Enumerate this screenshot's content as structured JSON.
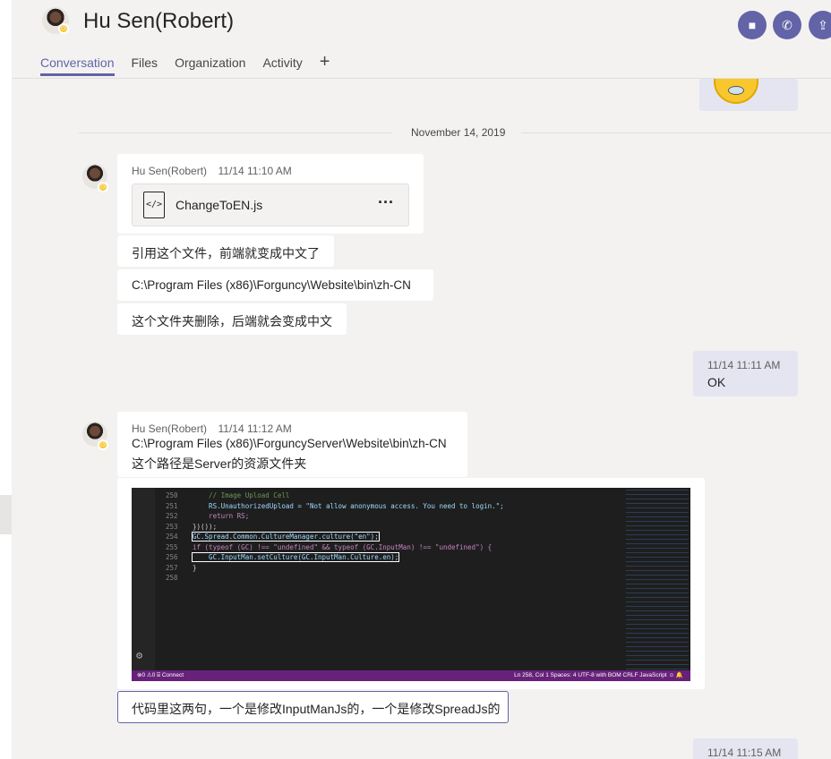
{
  "header": {
    "title": "Hu Sen(Robert)",
    "tabs": [
      {
        "label": "Conversation",
        "active": true
      },
      {
        "label": "Files"
      },
      {
        "label": "Organization"
      },
      {
        "label": "Activity"
      }
    ],
    "add_tab_icon": "+",
    "calls": [
      "video-icon",
      "phone-icon",
      "share-screen-icon"
    ]
  },
  "date_separator": "November 14, 2019",
  "messages": {
    "m1": {
      "sender": "Hu Sen(Robert)",
      "time": "11/14 11:10 AM",
      "file_name": "ChangeToEN.js",
      "file_more": "···"
    },
    "m2": {
      "text": "引用这个文件，前端就变成中文了"
    },
    "m3": {
      "text": "C:\\Program Files (x86)\\Forguncy\\Website\\bin\\zh-CN"
    },
    "m4": {
      "text": "这个文件夹删除，后端就会变成中文"
    },
    "me1": {
      "time": "11/14 11:11 AM",
      "text": "OK"
    },
    "m5": {
      "sender": "Hu Sen(Robert)",
      "time": "11/14 11:12 AM",
      "line1": "C:\\Program Files (x86)\\ForguncyServer\\Website\\bin\\zh-CN",
      "line2": "这个路径是Server的资源文件夹"
    },
    "m6": {
      "text": "代码里这两句，一个是修改InputManJs的，一个是修改SpreadJs的"
    },
    "me2": {
      "time": "11/14 11:15 AM"
    }
  },
  "code_screenshot": {
    "line_numbers": [
      "250",
      "251",
      "252",
      "253",
      "254",
      "255",
      "256",
      "257",
      "258"
    ],
    "lines": [
      "    // Image Upload Cell",
      "    RS.UnauthorizedUpload = \"Not allow anonymous access. You need to login.\";",
      "    return RS;",
      "})());",
      "GC.Spread.Common.CultureManager.culture(\"en\");",
      "if (typeof (GC) !== \"undefined\" && typeof (GC.InputMan) !== \"undefined\") {",
      "    GC.InputMan.setCulture(GC.InputMan.Culture.en);",
      "}",
      ""
    ],
    "status_left": "⊗0 ⚠0   ⌸ Connect",
    "status_right": "Ln 258, Col 1    Spaces: 4    UTF-8 with BOM    CRLF    JavaScript    ☺  🔔"
  },
  "colors": {
    "accent": "#6264a7",
    "status_away": "#f8c72d"
  }
}
